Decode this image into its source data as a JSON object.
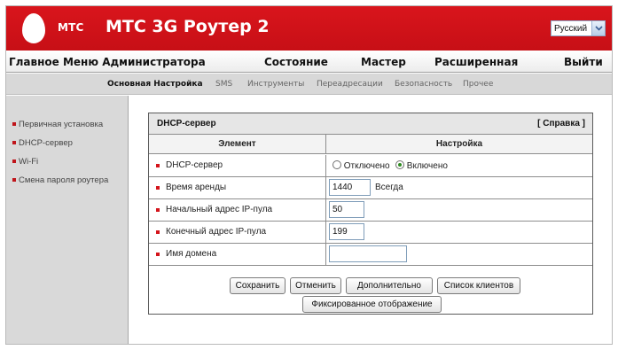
{
  "header": {
    "logo_text": "МТС",
    "title": "МТС 3G Роутер 2",
    "language": "Русский",
    "brand_color": "#d4141b"
  },
  "main_nav": [
    {
      "label": "Главное Меню Администратора"
    },
    {
      "label": "Состояние"
    },
    {
      "label": "Мастер"
    },
    {
      "label": "Расширенная"
    },
    {
      "label": "Выйти"
    }
  ],
  "sub_nav": [
    {
      "label": "Основная Настройка",
      "active": true
    },
    {
      "label": "SMS"
    },
    {
      "label": "Инструменты"
    },
    {
      "label": "Переадресации"
    },
    {
      "label": "Безопасность"
    },
    {
      "label": "Прочее"
    }
  ],
  "sidebar": {
    "items": [
      {
        "label": "Первичная установка"
      },
      {
        "label": "DHCP-сервер"
      },
      {
        "label": "Wi-Fi"
      },
      {
        "label": "Смена пароля роутера"
      }
    ]
  },
  "panel": {
    "title": "DHCP-сервер",
    "help": "[ Справка ]",
    "col_element": "Элемент",
    "col_setting": "Настройка",
    "rows": {
      "dhcp": {
        "label": "DHCP-сервер",
        "off_label": "Отключено",
        "on_label": "Включено",
        "selected": "on"
      },
      "lease": {
        "label": "Время аренды",
        "value": "1440",
        "suffix": "Всегда"
      },
      "start_ip": {
        "label": "Начальный адрес IP-пула",
        "value": "50"
      },
      "end_ip": {
        "label": "Конечный адрес IP-пула",
        "value": "199"
      },
      "domain": {
        "label": "Имя домена",
        "value": ""
      }
    },
    "buttons": {
      "save": "Сохранить",
      "cancel": "Отменить",
      "more": "Дополнительно",
      "clients": "Список клиентов",
      "fixed": "Фиксированное отображение"
    }
  }
}
